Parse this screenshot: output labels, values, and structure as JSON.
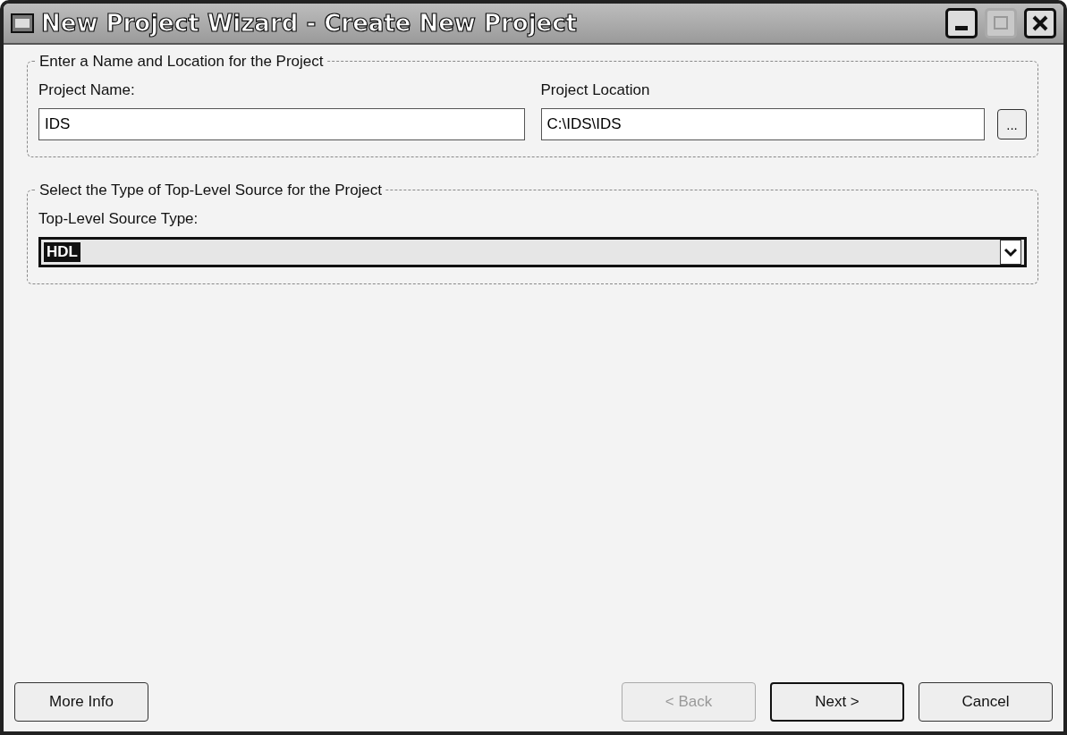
{
  "window": {
    "title": "New Project Wizard - Create New Project",
    "maximize_disabled": true
  },
  "groups": [
    {
      "kind": "fields",
      "legend": "Enter a Name and Location for the Project",
      "fields": [
        {
          "label": "Project Name:",
          "value": "IDS",
          "browse": false
        },
        {
          "label": "Project Location",
          "value": "C:\\IDS\\IDS",
          "browse": true,
          "browse_label": "..."
        }
      ]
    },
    {
      "kind": "combo",
      "legend": "Select the Type of Top-Level Source for the Project",
      "label": "Top-Level Source Type:",
      "value": "HDL",
      "selected": true
    }
  ],
  "left_buttons": [
    {
      "label": "More Info",
      "disabled": false,
      "default": false
    }
  ],
  "buttons": [
    {
      "label": "< Back",
      "disabled": true,
      "default": false
    },
    {
      "label": "Next >",
      "disabled": false,
      "default": true
    },
    {
      "label": "Cancel",
      "disabled": false,
      "default": false
    }
  ]
}
